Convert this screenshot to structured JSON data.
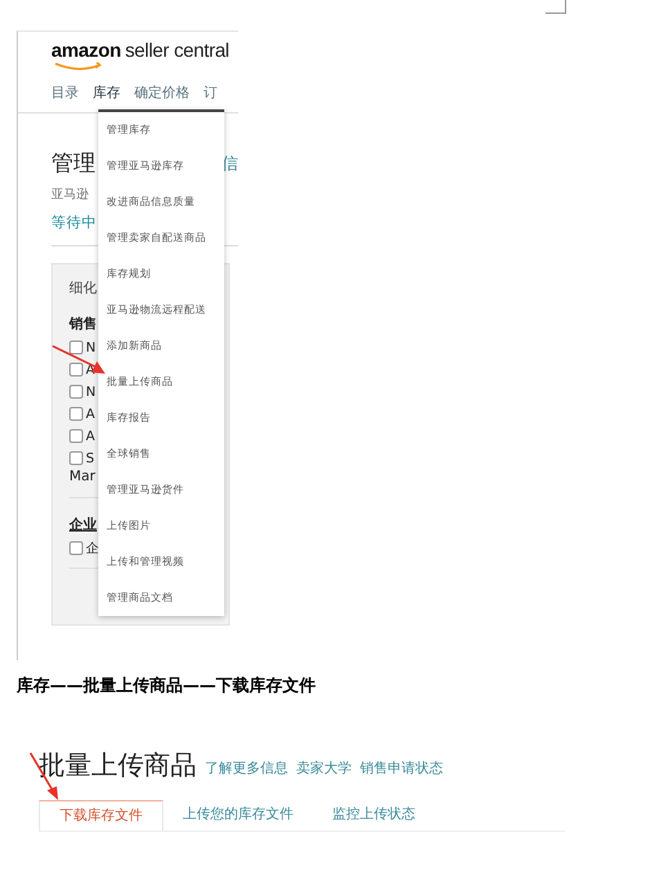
{
  "logo": {
    "brand": "amazon",
    "product": "seller central"
  },
  "nav": [
    {
      "label": "目录",
      "selected": false
    },
    {
      "label": "库存",
      "selected": true
    },
    {
      "label": "确定价格",
      "selected": false
    },
    {
      "label": "订",
      "selected": false
    }
  ],
  "dropdown": [
    "管理库存",
    "管理亚马逊库存",
    "改进商品信息质量",
    "管理卖家自配送商品",
    "库存规划",
    "亚马逊物流远程配送",
    "添加新商品",
    "批量上传商品",
    "库存报告",
    "全球销售",
    "管理亚马逊货件",
    "上传图片",
    "上传和管理视频",
    "管理商品文档"
  ],
  "page": {
    "heading": "管理",
    "heading_tail": "信",
    "subtitle": "亚马逊",
    "status_link": "等待中"
  },
  "filter_panel": {
    "title": "细化",
    "groups": [
      {
        "heading": "销售",
        "options": [
          {
            "label": "N",
            "checked": false
          },
          {
            "label": "A",
            "checked": false
          },
          {
            "label": "N",
            "checked": false
          },
          {
            "label": "A",
            "checked": false
          },
          {
            "label": "A",
            "checked": false
          },
          {
            "label": "S",
            "checked": false
          }
        ],
        "wrap_text": "Mar"
      },
      {
        "heading": "企业",
        "options": [
          {
            "label": "企",
            "checked": false
          }
        ]
      }
    ]
  },
  "caption": "库存——批量上传商品——下载库存文件",
  "bulk": {
    "heading": "批量上传商品",
    "links": [
      "了解更多信息",
      "卖家大学",
      "销售申请状态"
    ],
    "tabs": [
      {
        "label": "下载库存文件",
        "selected": true
      },
      {
        "label": "上传您的库存文件",
        "selected": false
      },
      {
        "label": "监控上传状态",
        "selected": false
      }
    ]
  }
}
